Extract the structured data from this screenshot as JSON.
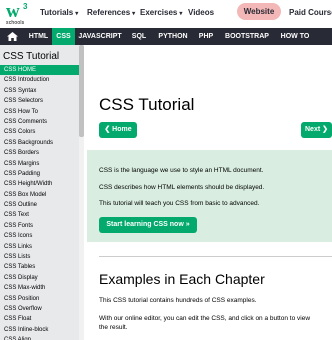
{
  "logo": {
    "mark": "w",
    "superscript": "3",
    "sub": "schools"
  },
  "topnav": {
    "tutorials": "Tutorials",
    "references": "References",
    "exercises": "Exercises",
    "videos": "Videos",
    "website": "Website",
    "paid_courses": "Paid Courses"
  },
  "darknav": {
    "items": [
      "HTML",
      "CSS",
      "JAVASCRIPT",
      "SQL",
      "PYTHON",
      "PHP",
      "BOOTSTRAP",
      "HOW TO"
    ],
    "active": "CSS"
  },
  "sidebar": {
    "title": "CSS Tutorial",
    "items": [
      "CSS HOME",
      "CSS Introduction",
      "CSS Syntax",
      "CSS Selectors",
      "CSS How To",
      "CSS Comments",
      "CSS Colors",
      "CSS Backgrounds",
      "CSS Borders",
      "CSS Margins",
      "CSS Padding",
      "CSS Height/Width",
      "CSS Box Model",
      "CSS Outline",
      "CSS Text",
      "CSS Fonts",
      "CSS Icons",
      "CSS Links",
      "CSS Lists",
      "CSS Tables",
      "CSS Display",
      "CSS Max-width",
      "CSS Position",
      "CSS Overflow",
      "CSS Float",
      "CSS Inline-block",
      "CSS Align"
    ],
    "active_index": 0
  },
  "main": {
    "title": "CSS Tutorial",
    "home_button": "❮ Home",
    "next_button": "Next ❯",
    "intro": [
      "CSS is the language we use to style an HTML document.",
      "CSS describes how HTML elements should be displayed.",
      "This tutorial will teach you CSS from basic to advanced."
    ],
    "start_button": "Start learning CSS now »",
    "section_title": "Examples in Each Chapter",
    "section_p1": "This CSS tutorial contains hundreds of CSS examples.",
    "section_p2_line1": "With our online editor, you can edit the CSS, and click on a button to view",
    "section_p2_line2": "the result."
  },
  "colors": {
    "brand": "#04aa6d",
    "dark": "#282a35",
    "sidebar": "#e7e9eb",
    "intro_bg": "#d9eee1",
    "website_btn": "#f3b7b7"
  }
}
